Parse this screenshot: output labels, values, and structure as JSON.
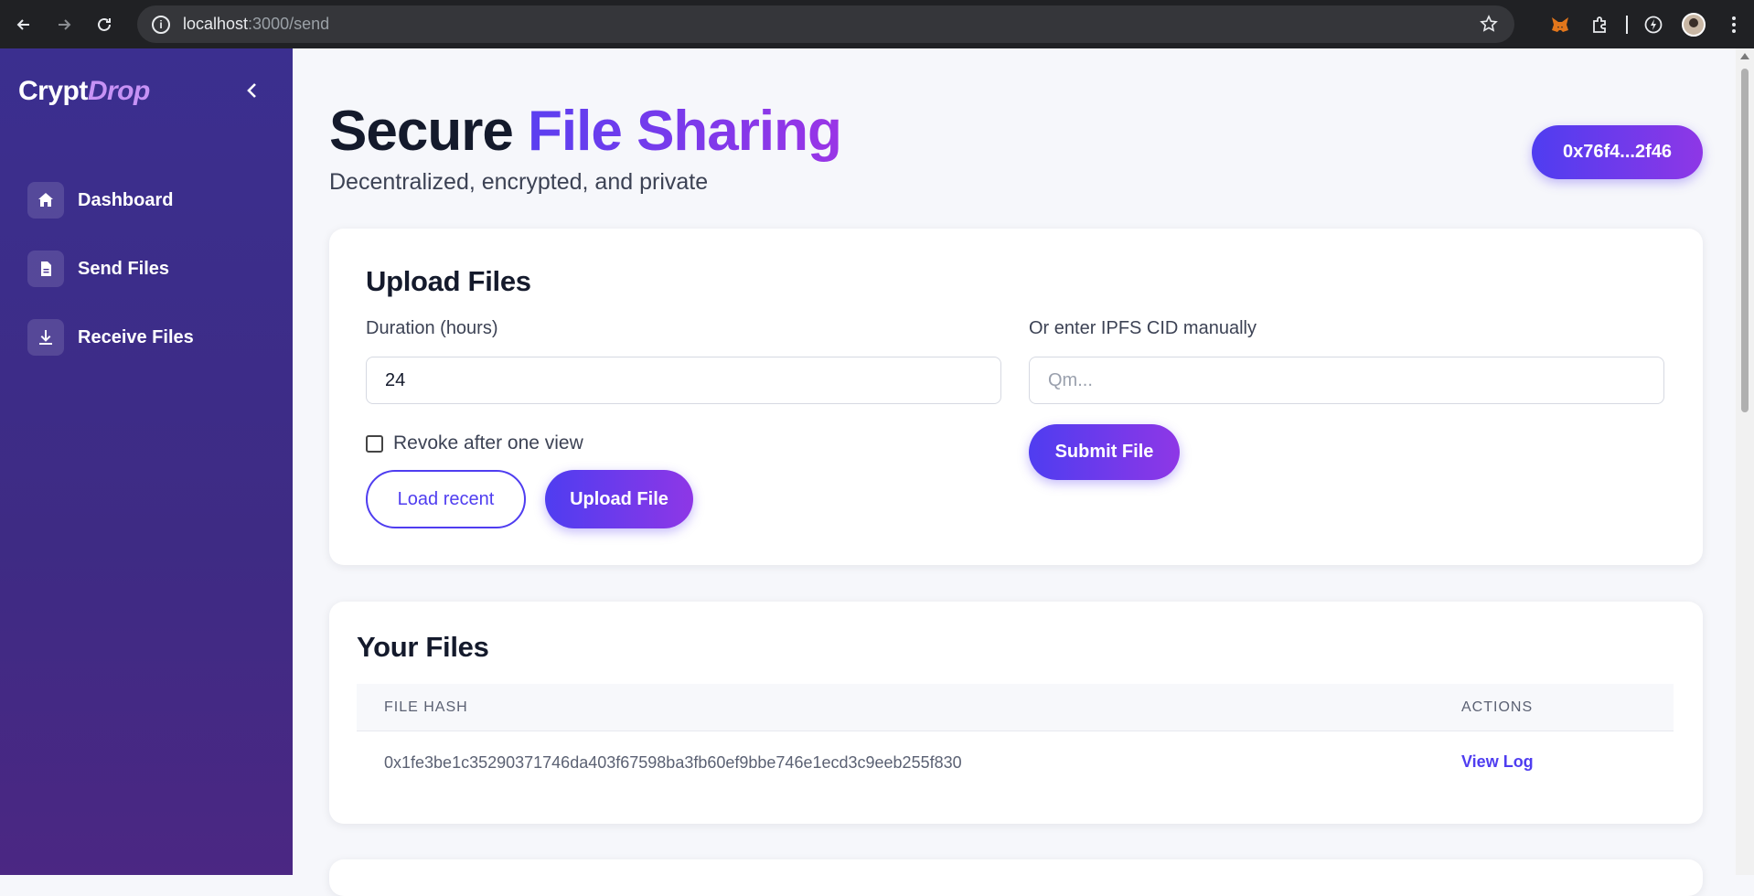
{
  "browser": {
    "url_host": "localhost",
    "url_path": ":3000/send"
  },
  "sidebar": {
    "logo_part1": "Crypt",
    "logo_part2": "Drop",
    "items": [
      {
        "label": "Dashboard",
        "icon": "home-icon"
      },
      {
        "label": "Send Files",
        "icon": "document-icon"
      },
      {
        "label": "Receive Files",
        "icon": "download-icon"
      }
    ]
  },
  "header": {
    "title_part1": "Secure",
    "title_part2": "File Sharing",
    "subtitle": "Decentralized, encrypted, and private",
    "wallet": "0x76f4...2f46"
  },
  "upload": {
    "heading": "Upload Files",
    "duration_label": "Duration (hours)",
    "duration_value": "24",
    "revoke_label": "Revoke after one view",
    "revoke_checked": false,
    "load_recent_label": "Load recent",
    "upload_label": "Upload File",
    "cid_label": "Or enter IPFS CID manually",
    "cid_placeholder": "Qm...",
    "submit_label": "Submit File"
  },
  "files": {
    "heading": "Your Files",
    "columns": [
      "FILE HASH",
      "ACTIONS"
    ],
    "rows": [
      {
        "hash": "0x1fe3be1c35290371746da403f67598ba3fb60ef9bbe746e1ecd3c9eeb255f830",
        "action": "View Log"
      }
    ]
  },
  "colors": {
    "accent": "#4f3df0",
    "accent_end": "#8e37e6",
    "sidebar_bg": "#3b2f8f"
  }
}
